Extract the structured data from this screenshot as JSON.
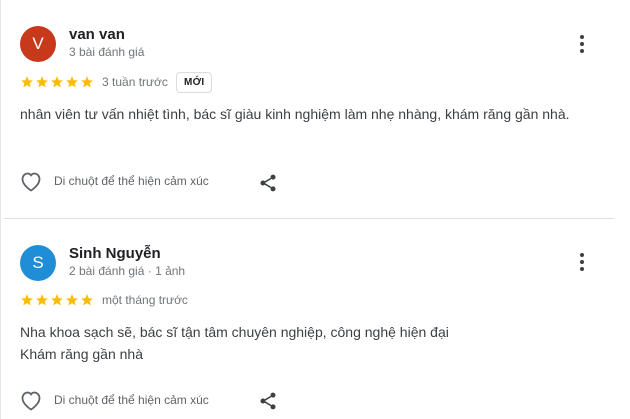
{
  "reviews": [
    {
      "avatar_letter": "V",
      "avatar_color": "#c8391b",
      "name": "van van",
      "meta": "3 bài đánh giá",
      "stars": 5,
      "time": "3 tuần trước",
      "badge": "MỚI",
      "text": "nhân viên tư vấn nhiệt tình, bác sĩ giàu kinh nghiệm làm nhẹ nhàng, khám răng gần nhà.",
      "react_label": "Di chuột để thể hiện cảm xúc",
      "more_icon": "more-vert-icon",
      "share_icon": "share-icon"
    },
    {
      "avatar_letter": "S",
      "avatar_color": "#1f8ed6",
      "name": "Sinh Nguyễn",
      "meta": "2 bài đánh giá · 1 ảnh",
      "stars": 5,
      "time": "một tháng trước",
      "text_line1": "Nha khoa sạch sẽ, bác sĩ tận tâm chuyên nghiệp, công nghệ hiện đại",
      "text_line2": "Khám răng gần nhà",
      "react_label": "Di chuột để thể hiện cảm xúc",
      "more_icon": "more-vert-icon",
      "share_icon": "share-icon"
    }
  ],
  "colors": {
    "star": "#fbbc04",
    "text": "#3c4043",
    "meta": "#70757a"
  }
}
